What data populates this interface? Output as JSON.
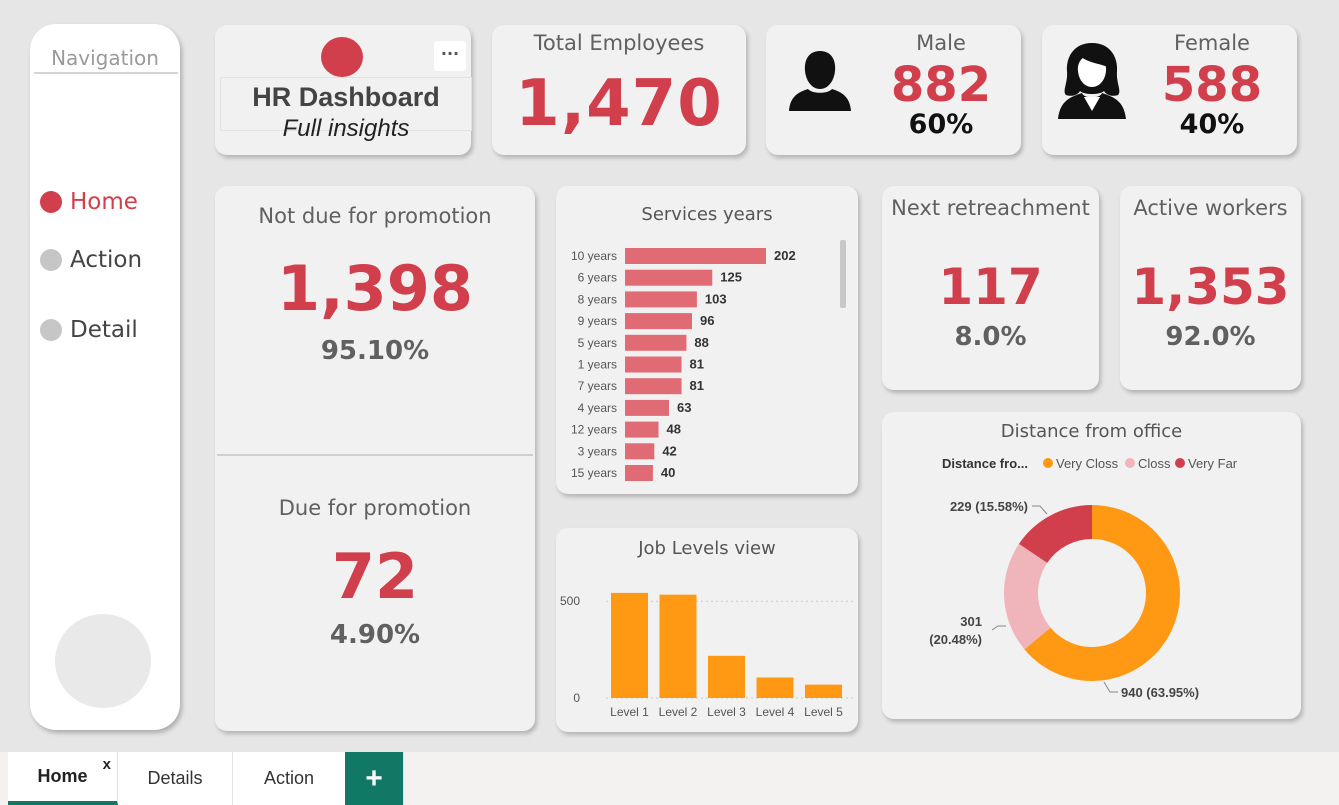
{
  "nav": {
    "title": "Navigation",
    "items": [
      {
        "label": "Home",
        "active": true
      },
      {
        "label": "Action",
        "active": false
      },
      {
        "label": "Detail",
        "active": false
      }
    ]
  },
  "header": {
    "title": "HR Dashboard",
    "subtitle": "Full insights",
    "more_icon": "ellipsis-icon",
    "more_label": "···"
  },
  "total": {
    "title": "Total Employees",
    "value": "1,470"
  },
  "male": {
    "title": "Male",
    "value": "882",
    "pct": "60%",
    "icon": "male-person-icon"
  },
  "female": {
    "title": "Female",
    "value": "588",
    "pct": "40%",
    "icon": "female-person-icon"
  },
  "not_due": {
    "title": "Not due for promotion",
    "value": "1,398",
    "pct": "95.10%"
  },
  "due": {
    "title": "Due for promotion",
    "value": "72",
    "pct": "4.90%"
  },
  "retrench": {
    "title": "Next retreachment",
    "value": "117",
    "pct": "8.0%"
  },
  "active": {
    "title": "Active workers",
    "value": "1,353",
    "pct": "92.0%"
  },
  "services": {
    "title": "Services years"
  },
  "job_levels": {
    "title": "Job Levels view"
  },
  "distance": {
    "title": "Distance from office",
    "legend_title": "Distance fro..."
  },
  "tabs": [
    {
      "label": "Home",
      "active": true,
      "close": "x"
    },
    {
      "label": "Details",
      "active": false
    },
    {
      "label": "Action",
      "active": false
    }
  ],
  "add_tab_label": "+",
  "colors": {
    "accent_red": "#d13f4c",
    "bar_red": "#e06b74",
    "orange": "#ff9914",
    "pink": "#f0b5ba",
    "tab_green": "#117865"
  },
  "chart_data": [
    {
      "type": "bar",
      "orientation": "horizontal",
      "title": "Services years",
      "categories": [
        "10 years",
        "6 years",
        "8 years",
        "9 years",
        "5 years",
        "1 years",
        "7 years",
        "4 years",
        "12 years",
        "3 years",
        "15 years"
      ],
      "values": [
        202,
        125,
        103,
        96,
        88,
        81,
        81,
        63,
        48,
        42,
        40
      ],
      "color": "#e06b74"
    },
    {
      "type": "bar",
      "title": "Job Levels view",
      "categories": [
        "Level 1",
        "Level 2",
        "Level 3",
        "Level 4",
        "Level 5"
      ],
      "values": [
        543,
        534,
        218,
        106,
        69
      ],
      "yticks": [
        0,
        500
      ],
      "ylim": [
        0,
        620
      ],
      "color": "#ff9914"
    },
    {
      "type": "pie",
      "donut": true,
      "title": "Distance from office",
      "legend_title": "Distance fro...",
      "legend_position": "top",
      "slices": [
        {
          "label": "Very Closs",
          "value": 940,
          "display": "940 (63.95%)",
          "color": "#ff9914"
        },
        {
          "label": "Closs",
          "value": 301,
          "display": "301 (20.48%)",
          "color": "#f0b5ba"
        },
        {
          "label": "Very Far",
          "value": 229,
          "display": "229 (15.58%)",
          "color": "#d13f4c"
        }
      ]
    }
  ]
}
